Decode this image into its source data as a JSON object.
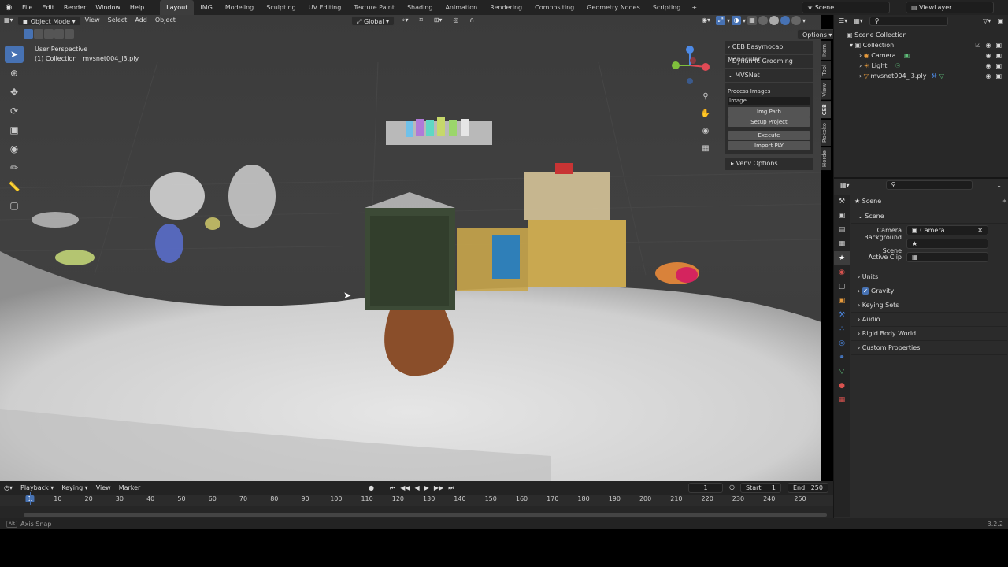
{
  "menu": {
    "items": [
      "File",
      "Edit",
      "Render",
      "Window",
      "Help"
    ],
    "workspaces": [
      "Layout",
      "IMG",
      "Modeling",
      "Sculpting",
      "UV Editing",
      "Texture Paint",
      "Shading",
      "Animation",
      "Rendering",
      "Compositing",
      "Geometry Nodes",
      "Scripting"
    ],
    "active_workspace": "Layout",
    "scene": "Scene",
    "view_layer": "ViewLayer"
  },
  "viewport_header": {
    "mode": "Object Mode",
    "view": "View",
    "select": "Select",
    "add": "Add",
    "object": "Object",
    "orientation": "Global",
    "options": "Options"
  },
  "viewport": {
    "perspective": "User Perspective",
    "collection_info": "(1) Collection | mvsnet004_l3.ply"
  },
  "npanel": {
    "sections": [
      "CEB Easymocap Monocular",
      "Dynamic Grooming",
      "MVSNet"
    ],
    "process_label": "Process Images",
    "image_field": "Image...",
    "buttons": [
      "Img Path",
      "Setup Project",
      "Execute",
      "Import PLY"
    ],
    "venv": "Venv Options",
    "tabs": [
      "Item",
      "Tool",
      "View",
      "CEB",
      "Rokoko",
      "Horde"
    ]
  },
  "timeline": {
    "playback": "Playback",
    "keying": "Keying",
    "view": "View",
    "marker": "Marker",
    "current_frame": "1",
    "start_label": "Start",
    "start": "1",
    "end_label": "End",
    "end": "250",
    "ticks": [
      "1",
      "10",
      "20",
      "30",
      "40",
      "50",
      "60",
      "70",
      "80",
      "90",
      "100",
      "110",
      "120",
      "130",
      "140",
      "150",
      "160",
      "170",
      "180",
      "190",
      "200",
      "210",
      "220",
      "230",
      "240",
      "250"
    ]
  },
  "outliner": {
    "root": "Scene Collection",
    "collection": "Collection",
    "items": [
      "Camera",
      "Light",
      "mvsnet004_l3.ply"
    ]
  },
  "properties": {
    "breadcrumb": "Scene",
    "panel": "Scene",
    "camera_label": "Camera",
    "camera_value": "Camera",
    "background_label": "Background Scene",
    "active_clip_label": "Active Clip",
    "sections": [
      "Units",
      "Gravity",
      "Keying Sets",
      "Audio",
      "Rigid Body World",
      "Custom Properties"
    ]
  },
  "status": {
    "hint": "Axis Snap",
    "version": "3.2.2"
  },
  "colors": {
    "accent": "#4772b3",
    "panel": "#2b2b2b",
    "viewport": "#3f3f3f"
  }
}
